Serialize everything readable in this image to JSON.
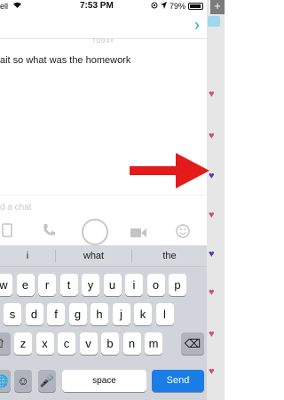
{
  "status": {
    "carrier": "ell",
    "time": "7:53 PM",
    "battery": "79%",
    "battery_level": 0.79
  },
  "chat": {
    "day_label": "TODAY",
    "messages": [
      "ait so what was the homework"
    ],
    "input_placeholder": "d a chat"
  },
  "keyboard": {
    "suggestions": [
      "i",
      "what",
      "the"
    ],
    "row1": [
      "w",
      "e",
      "r",
      "t",
      "y",
      "u",
      "i",
      "o",
      "p"
    ],
    "row2": [
      "s",
      "d",
      "f",
      "g",
      "h",
      "j",
      "k",
      "l"
    ],
    "row3": [
      "z",
      "x",
      "c",
      "v",
      "b",
      "n",
      "m"
    ],
    "space_label": "space",
    "send_label": "Send"
  },
  "colors": {
    "send_key": "#1a7ee6",
    "arrow": "#e31b1b",
    "accent": "#19a7b9"
  }
}
